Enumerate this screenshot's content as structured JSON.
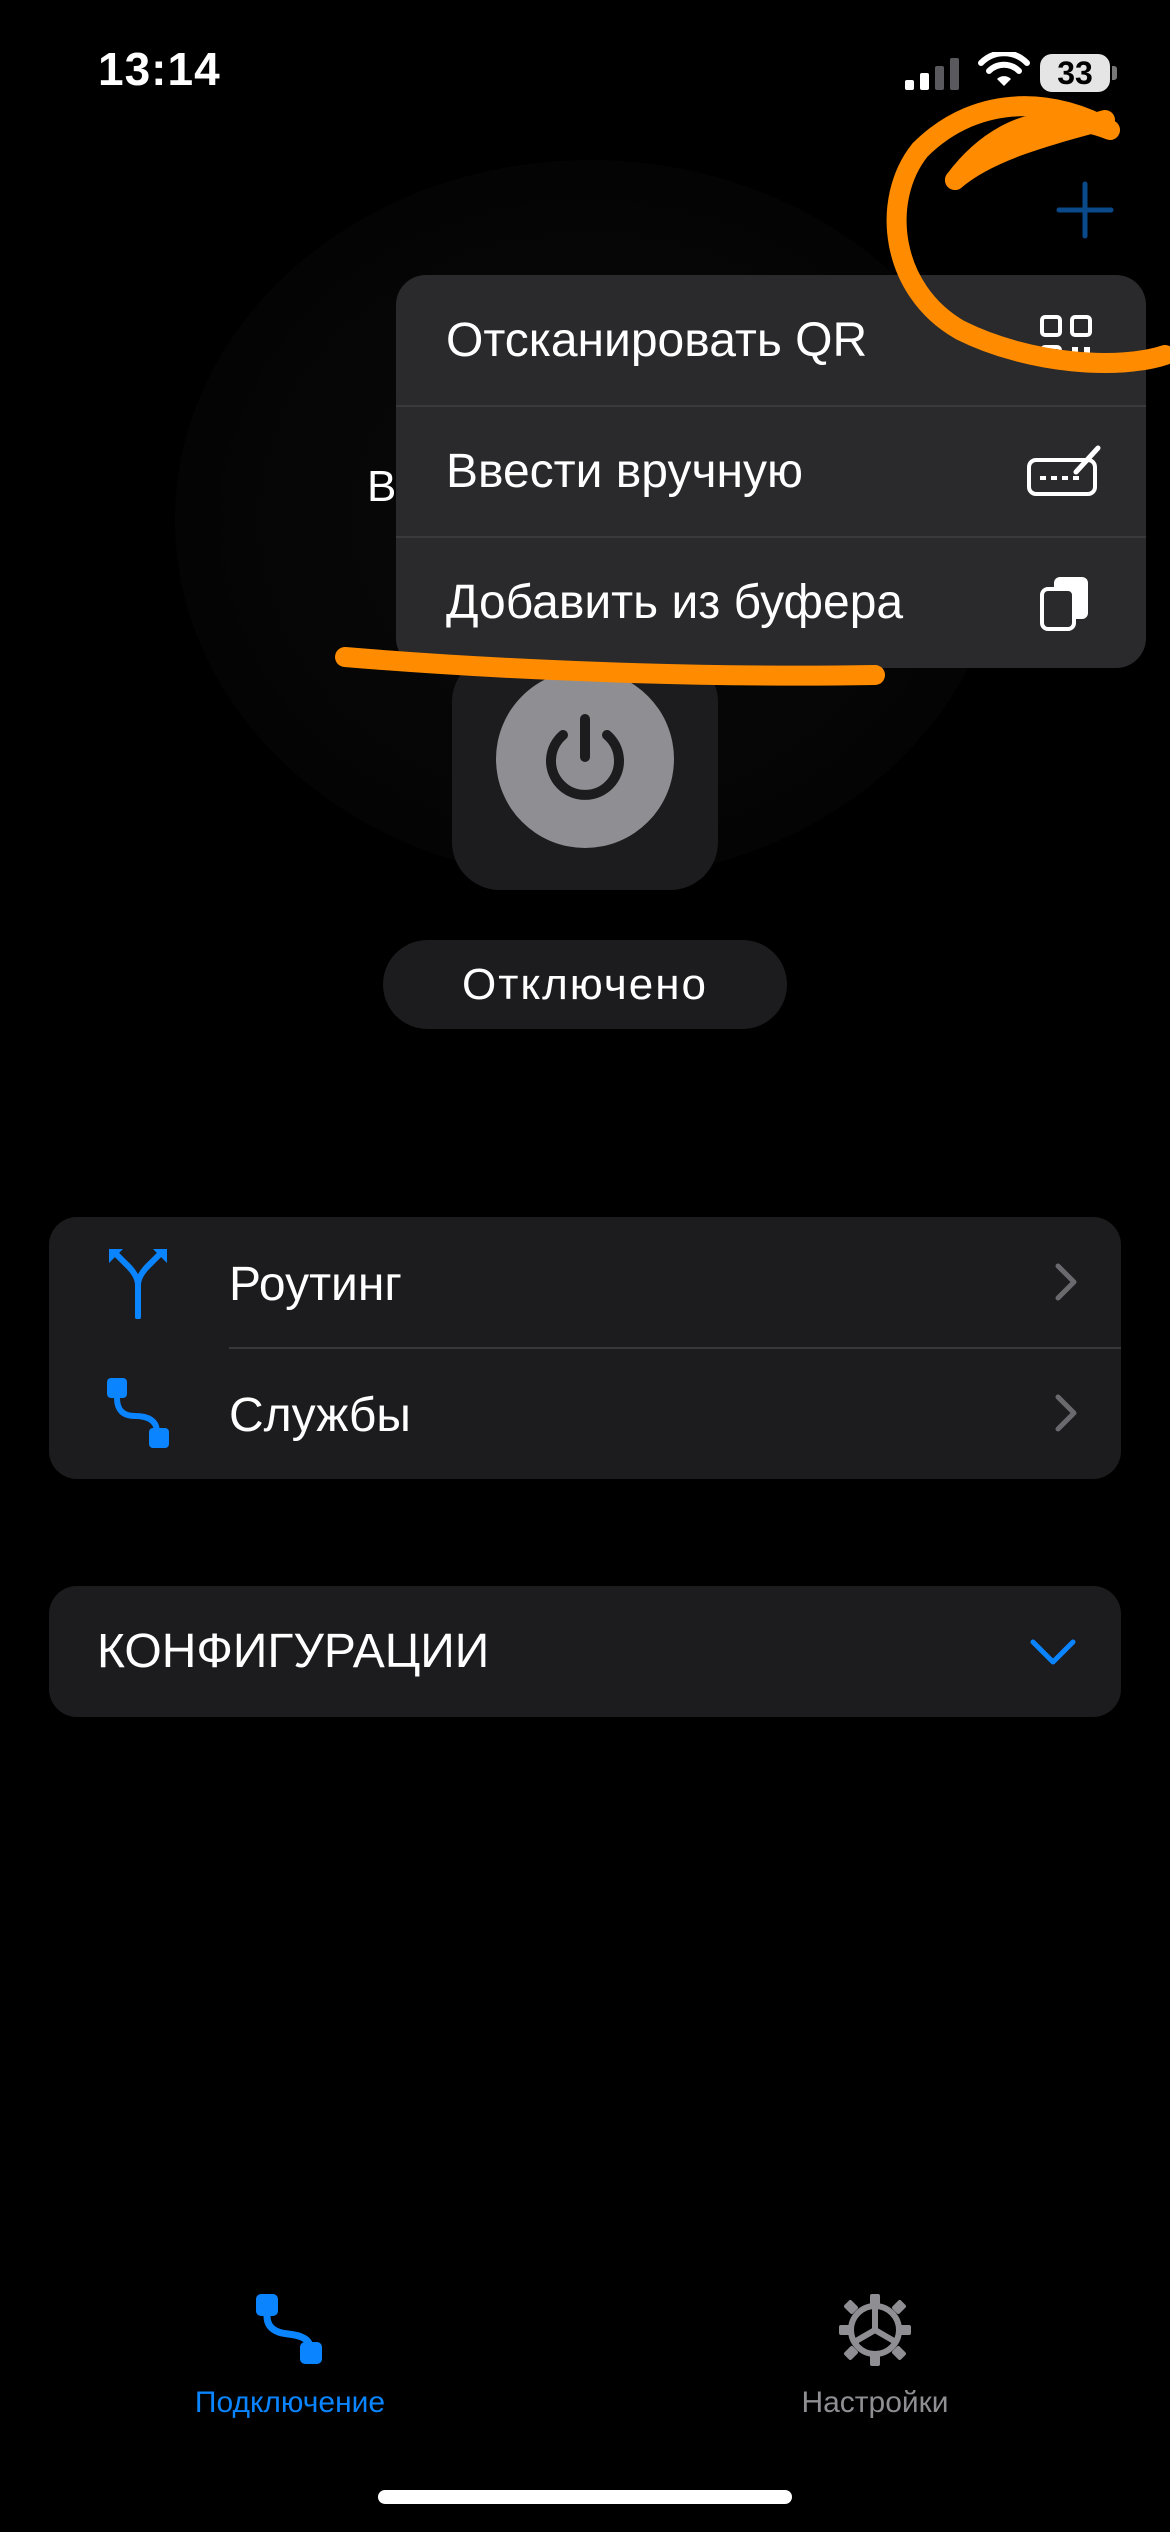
{
  "status_bar": {
    "time": "13:14",
    "battery": "33",
    "icons": [
      "signal-icon",
      "wifi-icon",
      "battery-icon"
    ]
  },
  "nav": {
    "add_icon": "plus-icon"
  },
  "background": {
    "partial_text": "В"
  },
  "menu": {
    "items": [
      {
        "label": "Отсканировать QR",
        "icon": "qr-code-icon"
      },
      {
        "label": "Ввести вручную",
        "icon": "keyboard-pencil-icon"
      },
      {
        "label": "Добавить из буфера",
        "icon": "clipboard-icon"
      }
    ]
  },
  "connection": {
    "power_icon": "power-icon",
    "status": "Отключено"
  },
  "list": {
    "items": [
      {
        "label": "Роутинг",
        "icon": "routing-icon"
      },
      {
        "label": "Службы",
        "icon": "services-icon"
      }
    ]
  },
  "configs": {
    "title": "КОНФИГУРАЦИИ",
    "icon": "chevron-down-icon"
  },
  "tabbar": {
    "tabs": [
      {
        "label": "Подключение",
        "icon": "connection-icon",
        "active": true
      },
      {
        "label": "Настройки",
        "icon": "gear-icon",
        "active": false
      }
    ]
  },
  "colors": {
    "accent": "#0a84ff",
    "annotation": "#ff8c00",
    "background": "#000000",
    "card": "#1c1c1e",
    "menu": "#2a2a2c"
  }
}
